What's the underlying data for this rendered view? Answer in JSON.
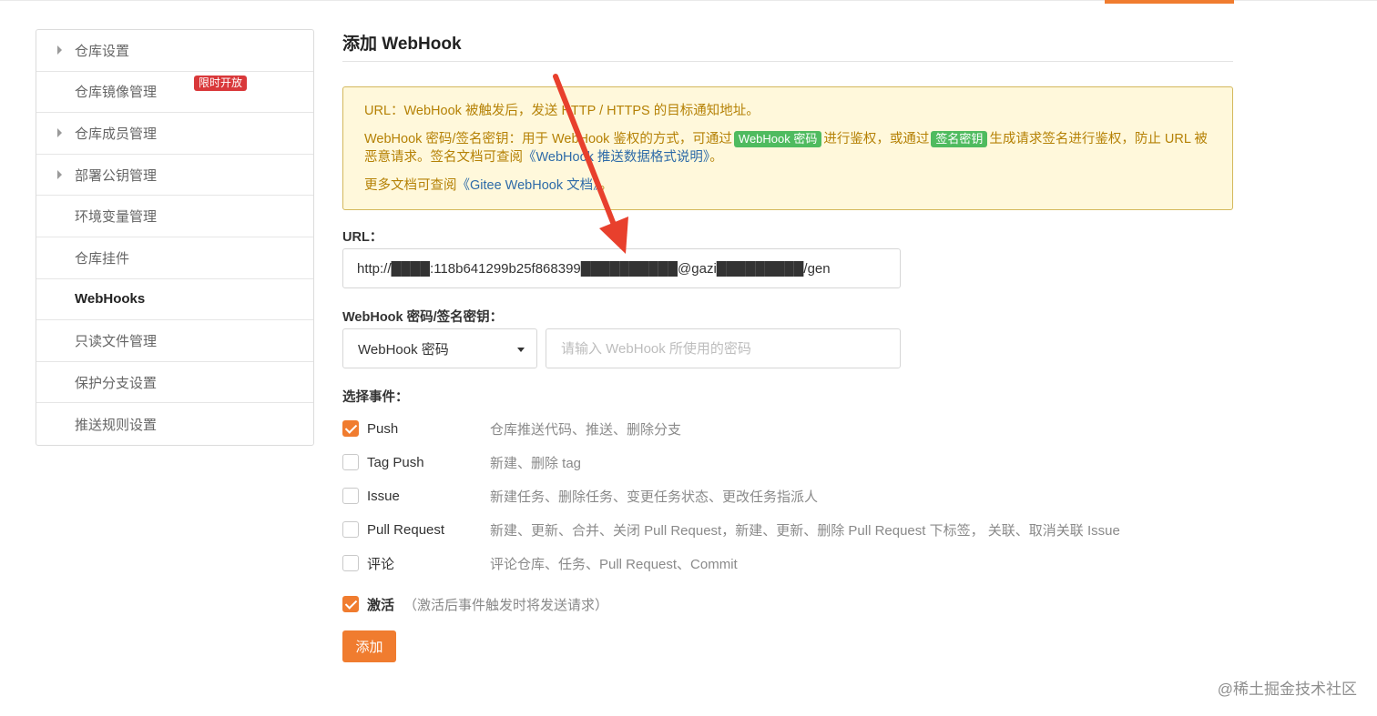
{
  "sidebar": {
    "items": [
      {
        "label": "仓库设置",
        "caret": true,
        "active": false
      },
      {
        "label": "仓库镜像管理",
        "caret": false,
        "active": false,
        "badge": "限时开放"
      },
      {
        "label": "仓库成员管理",
        "caret": true,
        "active": false
      },
      {
        "label": "部署公钥管理",
        "caret": true,
        "active": false
      },
      {
        "label": "环境变量管理",
        "caret": false,
        "active": false
      },
      {
        "label": "仓库挂件",
        "caret": false,
        "active": false
      },
      {
        "label": "WebHooks",
        "caret": false,
        "active": true
      },
      {
        "label": "只读文件管理",
        "caret": false,
        "active": false
      },
      {
        "label": "保护分支设置",
        "caret": false,
        "active": false
      },
      {
        "label": "推送规则设置",
        "caret": false,
        "active": false
      }
    ]
  },
  "main": {
    "title": "添加 WebHook",
    "notice": {
      "line1": "URL：WebHook 被触发后，发送 HTTP / HTTPS 的目标通知地址。",
      "line2_a": "WebHook 密码/签名密钥：用于 WebHook 鉴权的方式，可通过",
      "tag_password": "WebHook 密码",
      "line2_b": "进行鉴权，或通过",
      "tag_signature": "签名密钥",
      "line2_c": "生成请求签名进行鉴权，防止 URL 被恶意请求。签名文档可查阅",
      "doc_link_1": "《WebHook 推送数据格式说明》",
      "line2_end": "。",
      "line3_a": "更多文档可查阅",
      "doc_link_2": "《Gitee WebHook 文档》",
      "line3_end": "。"
    },
    "url": {
      "label": "URL：",
      "value": "http://████:118b641299b25f868399██████████@gazi█████████/gen"
    },
    "secret": {
      "label": "WebHook 密码/签名密钥：",
      "select_value": "WebHook 密码",
      "placeholder": "请输入 WebHook 所使用的密码"
    },
    "events": {
      "label": "选择事件：",
      "items": [
        {
          "name": "Push",
          "desc": "仓库推送代码、推送、删除分支",
          "checked": true
        },
        {
          "name": "Tag Push",
          "desc": "新建、删除 tag",
          "checked": false
        },
        {
          "name": "Issue",
          "desc": "新建任务、删除任务、变更任务状态、更改任务指派人",
          "checked": false
        },
        {
          "name": "Pull Request",
          "desc": "新建、更新、合并、关闭 Pull Request，新建、更新、删除 Pull Request 下标签， 关联、取消关联 Issue",
          "checked": false
        },
        {
          "name": "评论",
          "desc": "评论仓库、任务、Pull Request、Commit",
          "checked": false
        }
      ]
    },
    "activate": {
      "label": "激活",
      "hint": "（激活后事件触发时将发送请求）",
      "checked": true
    },
    "add_button": "添加"
  },
  "watermark": "@稀土掘金技术社区",
  "colors": {
    "accent": "#f07c2f",
    "notice_bg": "#fff8db",
    "notice_text": "#b58105",
    "tag_green": "#4fbb5f",
    "badge_red": "#d9383a",
    "arrow_red": "#e8402d"
  }
}
